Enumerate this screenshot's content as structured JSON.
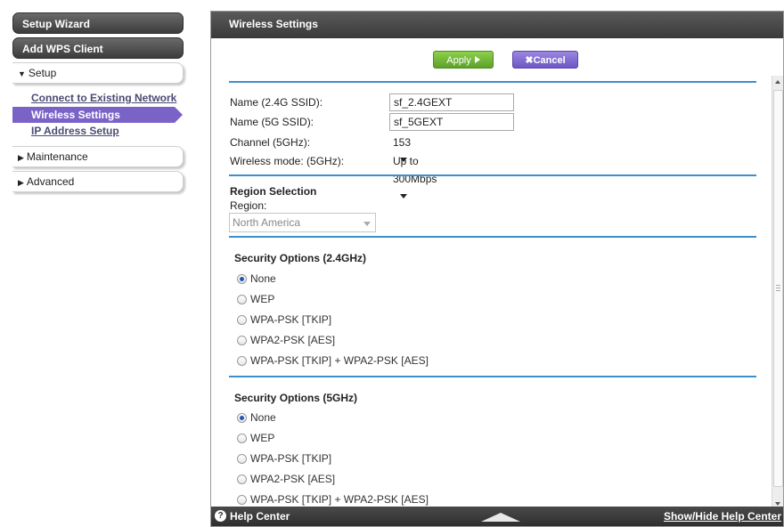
{
  "sidebar": {
    "setup_wizard": "Setup Wizard",
    "add_wps_client": "Add WPS Client",
    "setup_menu": "Setup",
    "setup_items": [
      {
        "label": "Connect to Existing Network"
      },
      {
        "label": "Wireless Settings",
        "active": true
      },
      {
        "label": "IP Address Setup"
      }
    ],
    "maintenance_menu": "Maintenance",
    "advanced_menu": "Advanced"
  },
  "panel": {
    "title": "Wireless Settings",
    "apply_label": "Apply",
    "cancel_label": "Cancel",
    "cancel_icon": "x-icon"
  },
  "wireless": {
    "name_24g_label": "Name (2.4G SSID):",
    "name_24g_value": "sf_2.4GEXT",
    "name_5g_label": "Name (5G SSID):",
    "name_5g_value": "sf_5GEXT",
    "channel_label": "Channel (5GHz):",
    "channel_value": "153",
    "mode_label": "Wireless mode: (5GHz):",
    "mode_value": "Up to 300Mbps"
  },
  "region": {
    "section_title": "Region Selection",
    "label": "Region:",
    "value": "North America"
  },
  "security_24": {
    "title": "Security Options (2.4GHz)",
    "options": [
      {
        "label": "None",
        "checked": true
      },
      {
        "label": "WEP",
        "checked": false
      },
      {
        "label": "WPA-PSK [TKIP]",
        "checked": false
      },
      {
        "label": "WPA2-PSK [AES]",
        "checked": false
      },
      {
        "label": "WPA-PSK [TKIP] + WPA2-PSK [AES]",
        "checked": false
      }
    ]
  },
  "security_5": {
    "title": "Security Options (5GHz)",
    "options": [
      {
        "label": "None",
        "checked": true
      },
      {
        "label": "WEP",
        "checked": false
      },
      {
        "label": "WPA-PSK [TKIP]",
        "checked": false
      },
      {
        "label": "WPA2-PSK [AES]",
        "checked": false
      },
      {
        "label": "WPA-PSK [TKIP] + WPA2-PSK [AES]",
        "checked": false
      }
    ]
  },
  "help": {
    "label": "Help Center",
    "toggle_label": "Show/Hide Help Center"
  },
  "colors": {
    "accent_blue": "#3d8fcb",
    "active_purple": "#7a63c7",
    "apply_green": "#6db536"
  }
}
